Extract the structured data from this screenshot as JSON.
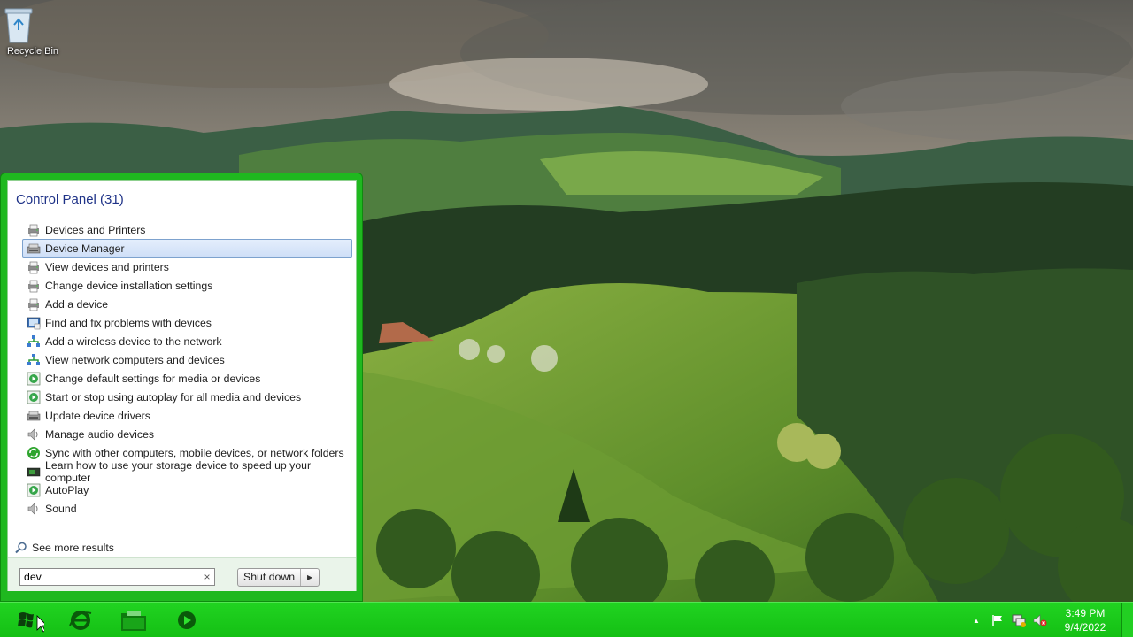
{
  "desktop": {
    "recycle_bin_label": "Recycle Bin"
  },
  "start_menu": {
    "group_title": "Control Panel (31)",
    "results": [
      {
        "label": "Devices and Printers",
        "icon": "printer-icon"
      },
      {
        "label": "Device Manager",
        "icon": "device-manager-icon",
        "selected": true
      },
      {
        "label": "View devices and printers",
        "icon": "printer-icon"
      },
      {
        "label": "Change device installation settings",
        "icon": "printer-icon"
      },
      {
        "label": "Add a device",
        "icon": "printer-icon"
      },
      {
        "label": "Find and fix problems with devices",
        "icon": "troubleshoot-icon"
      },
      {
        "label": "Add a wireless device to the network",
        "icon": "network-icon"
      },
      {
        "label": "View network computers and devices",
        "icon": "network-icon"
      },
      {
        "label": "Change default settings for media or devices",
        "icon": "autoplay-icon"
      },
      {
        "label": "Start or stop using autoplay for all media and devices",
        "icon": "autoplay-icon"
      },
      {
        "label": "Update device drivers",
        "icon": "device-manager-icon"
      },
      {
        "label": "Manage audio devices",
        "icon": "speaker-icon"
      },
      {
        "label": "Sync with other computers, mobile devices, or network folders",
        "icon": "sync-icon"
      },
      {
        "label": "Learn how to use your storage device to speed up your computer",
        "icon": "readyboost-icon"
      },
      {
        "label": "AutoPlay",
        "icon": "autoplay-icon"
      },
      {
        "label": "Sound",
        "icon": "speaker-icon"
      }
    ],
    "see_more_label": "See more results",
    "search": {
      "value": "dev",
      "clear_glyph": "×"
    },
    "shutdown_label": "Shut down",
    "shutdown_arrow_glyph": "▶"
  },
  "taskbar": {
    "time": "3:49 PM",
    "date": "9/4/2022",
    "tray_overflow_glyph": "▲"
  },
  "colors": {
    "taskbar": "#14c014",
    "start_menu_frame": "#1fb81f",
    "selection_border": "#7da2ce",
    "group_title": "#1e3287"
  }
}
